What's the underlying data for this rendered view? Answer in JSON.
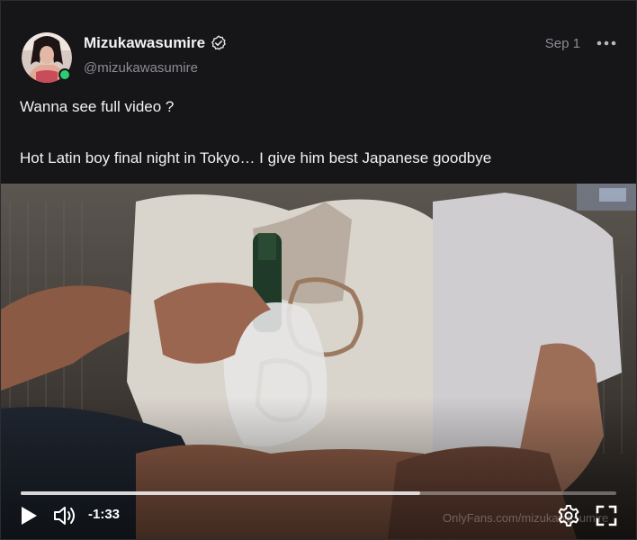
{
  "post": {
    "author": {
      "display_name": "Mizukawasumire",
      "handle": "@mizukawasumire",
      "verified": true,
      "online": true
    },
    "date": "Sep 1",
    "text_lines": [
      "Wanna see full video ?",
      "Hot Latin boy final night in Tokyo… I give him best Japanese goodbye"
    ]
  },
  "video": {
    "time_remaining": "-1:33",
    "progress": 0.67,
    "watermark": "OnlyFans.com/mizukawasumire",
    "controls": [
      "play-icon",
      "volume-icon",
      "settings-icon",
      "fullscreen-icon"
    ]
  },
  "colors": {
    "background": "#161618",
    "text_primary": "#f2f2f2",
    "text_secondary": "#8a8d93",
    "online": "#2ecc71"
  }
}
